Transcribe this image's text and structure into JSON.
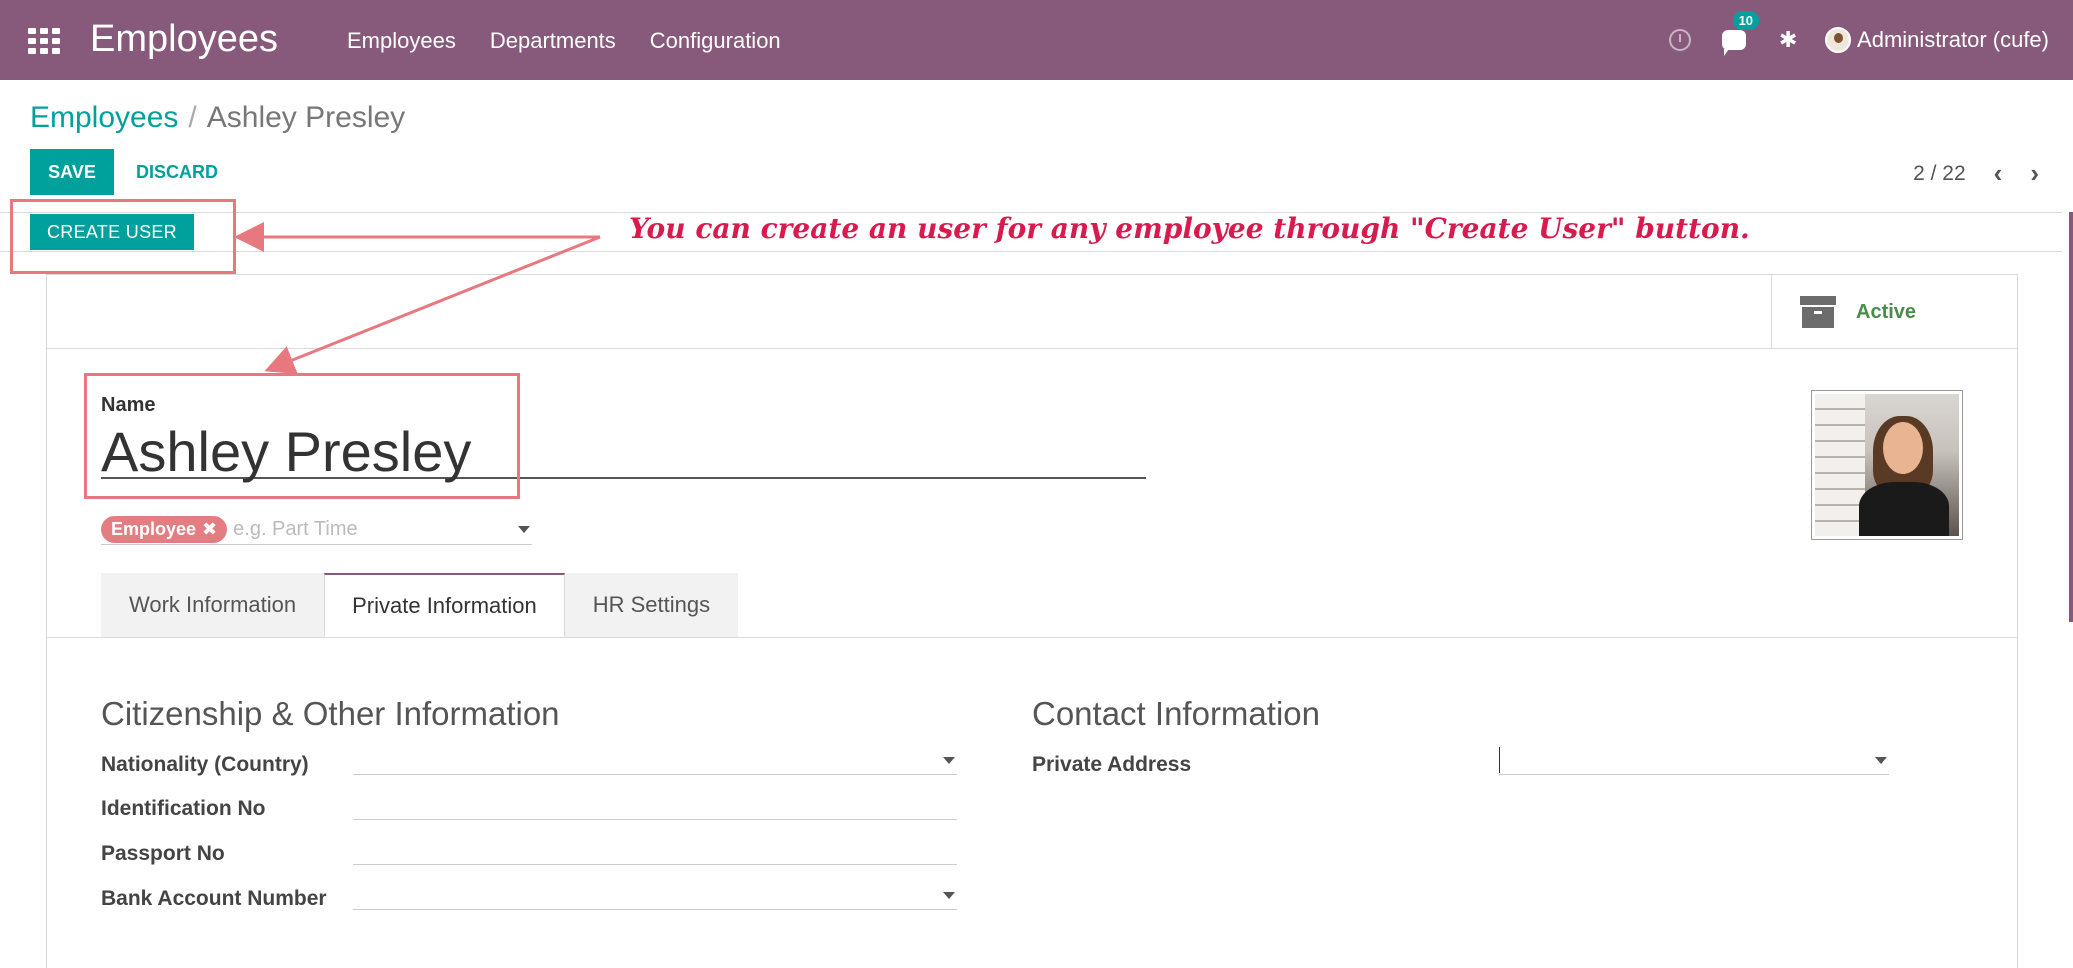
{
  "navbar": {
    "app_title": "Employees",
    "menu": [
      "Employees",
      "Departments",
      "Configuration"
    ],
    "messages_count": "10",
    "user_name": "Administrator (cufe)",
    "icons": [
      "apps-grid-icon",
      "clock-icon",
      "chat-icon",
      "bug-icon",
      "avatar"
    ]
  },
  "breadcrumb": {
    "parent": "Employees",
    "separator": "/",
    "current": "Ashley Presley"
  },
  "toolbar": {
    "save_label": "SAVE",
    "discard_label": "DISCARD",
    "pager": "2 / 22"
  },
  "statusbar": {
    "create_user_label": "CREATE USER"
  },
  "annotation": {
    "text": "You can create an user for any employee through \"Create User\" button."
  },
  "button_box": {
    "active_label": "Active"
  },
  "employee": {
    "name_label": "Name",
    "name": "Ashley Presley",
    "tags": [
      "Employee"
    ],
    "tags_placeholder": "e.g. Part Time"
  },
  "tabs": [
    {
      "label": "Work Information",
      "active": false
    },
    {
      "label": "Private Information",
      "active": true
    },
    {
      "label": "HR Settings",
      "active": false
    }
  ],
  "citizenship": {
    "title": "Citizenship & Other Information",
    "fields": [
      {
        "label": "Nationality (Country)",
        "value": ""
      },
      {
        "label": "Identification No",
        "value": ""
      },
      {
        "label": "Passport No",
        "value": ""
      },
      {
        "label": "Bank Account Number",
        "value": ""
      }
    ]
  },
  "contact": {
    "title": "Contact Information",
    "fields": [
      {
        "label": "Private Address",
        "value": ""
      }
    ]
  },
  "colors": {
    "navbar": "#875a7b",
    "primary": "#00a09d",
    "tag": "#e47d82",
    "annotation": "#e8787f",
    "annotation_text": "#d81b4f",
    "active_status": "#4a8c4a"
  }
}
